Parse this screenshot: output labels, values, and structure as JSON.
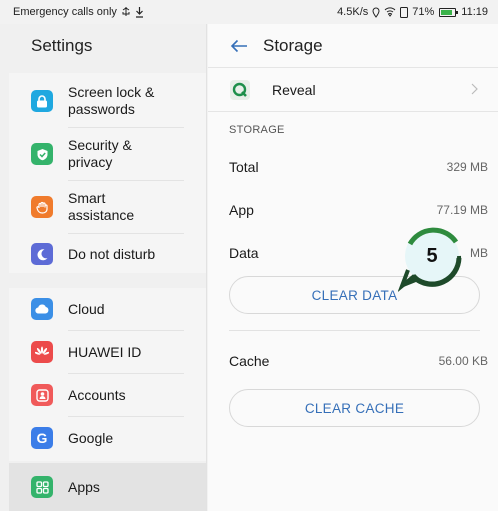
{
  "status": {
    "left_text": "Emergency calls only",
    "right_text": "4.5K/s",
    "battery": "71%",
    "time": "11:19"
  },
  "settings": {
    "title": "Settings",
    "groups": [
      {
        "items": [
          {
            "label": "Screen lock & passwords",
            "icon": "lock-icon",
            "color": "#1fa8e0"
          },
          {
            "label": "Security & privacy",
            "icon": "shield-check-icon",
            "color": "#34b36b"
          },
          {
            "label": "Smart assistance",
            "icon": "hand-icon",
            "color": "#f07b2c"
          },
          {
            "label": "Do not disturb",
            "icon": "moon-icon",
            "color": "#5d6bd6"
          }
        ]
      },
      {
        "items": [
          {
            "label": "Cloud",
            "icon": "cloud-icon",
            "color": "#3b8fe6"
          },
          {
            "label": "HUAWEI ID",
            "icon": "huawei-icon",
            "color": "#ec4b4b"
          },
          {
            "label": "Accounts",
            "icon": "account-icon",
            "color": "#f05a5a"
          },
          {
            "label": "Google",
            "icon": "google-icon",
            "color": "#3b7de8"
          }
        ]
      },
      {
        "items": [
          {
            "label": "Apps",
            "icon": "apps-icon",
            "color": "#34b36b"
          }
        ]
      }
    ]
  },
  "storage": {
    "title": "Storage",
    "app_name": "Reveal",
    "section_label": "STORAGE",
    "total_label": "Total",
    "total_value": "329 MB",
    "app_label": "App",
    "app_value": "77.19 MB",
    "data_label": "Data",
    "data_value": "MB",
    "clear_data": "CLEAR DATA",
    "cache_label": "Cache",
    "cache_value": "56.00 KB",
    "clear_cache": "CLEAR CACHE"
  },
  "step_badge": "5",
  "colors": {
    "accent": "#356fb8",
    "badge_ring": "#2e8b3e",
    "badge_fill": "#e6f6f8"
  }
}
